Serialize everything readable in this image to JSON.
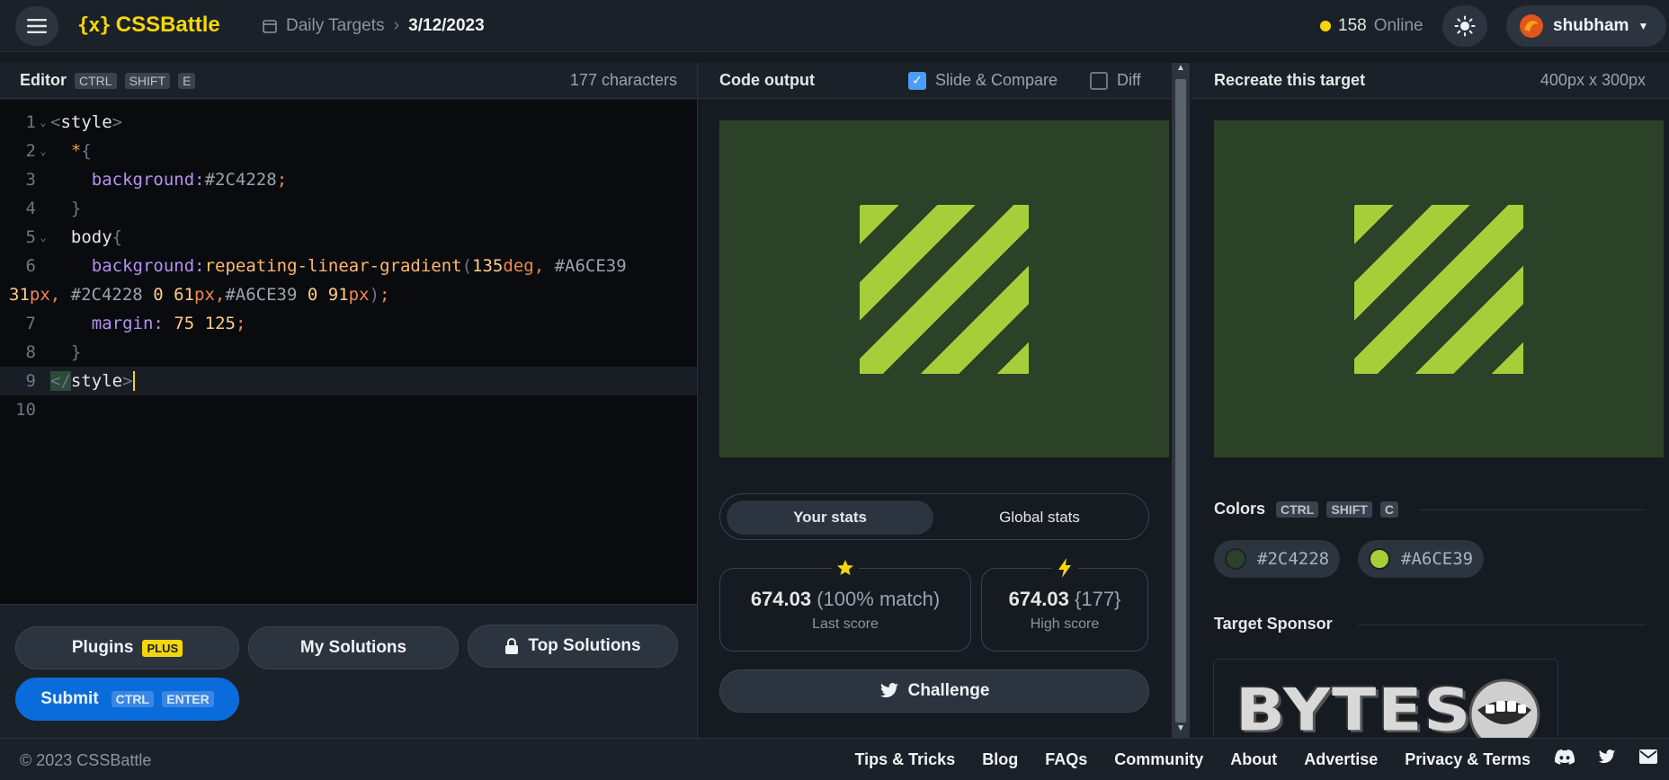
{
  "header": {
    "brand": "CSSBattle",
    "brand_mark": "{x}",
    "crumbs": [
      "Daily Targets",
      "3/12/2023"
    ],
    "online_count": "158",
    "online_label": "Online",
    "username": "shubham"
  },
  "editor": {
    "title": "Editor",
    "shortcut": [
      "CTRL",
      "SHIFT",
      "E"
    ],
    "char_count": "177 characters",
    "line_numbers": [
      "1",
      "2",
      "3",
      "4",
      "5",
      "6",
      "",
      "7",
      "8",
      "9",
      "10"
    ]
  },
  "code_tokens": {
    "style_tag": "style",
    "star": "*",
    "bg_prop": "background",
    "bg_val": "#2C4228",
    "body_sel": "body",
    "fn_name": "repeating-linear-gradient",
    "deg": "135",
    "deg_unit": "deg",
    "c1": "#A6CE39",
    "n31": "31",
    "c2": "#2C4228",
    "zero": "0",
    "n61": "61",
    "c3": "#A6CE39",
    "n91": "91",
    "px": "px",
    "margin_prop": "margin",
    "margin_val": "75 125"
  },
  "editor_buttons": {
    "plugins": "Plugins",
    "plus": "PLUS",
    "my_solutions": "My Solutions",
    "top_solutions": "Top Solutions",
    "submit": "Submit",
    "submit_keys": [
      "CTRL",
      "ENTER"
    ]
  },
  "output": {
    "title": "Code output",
    "slide_compare": "Slide & Compare",
    "diff": "Diff",
    "tabs": [
      "Your stats",
      "Global stats"
    ],
    "last_score": "674.03",
    "last_score_extra": "(100% match)",
    "last_score_label": "Last score",
    "high_score": "674.03",
    "high_score_extra": "{177}",
    "high_score_label": "High score",
    "challenge": "Challenge"
  },
  "target": {
    "title": "Recreate this target",
    "size": "400px x 300px",
    "colors_title": "Colors",
    "colors_keys": [
      "CTRL",
      "SHIFT",
      "C"
    ],
    "colors": [
      "#2C4228",
      "#A6CE39"
    ],
    "sponsor_title": "Target Sponsor",
    "sponsor_text": "BYTES"
  },
  "footer": {
    "copyright": "© 2023 CSSBattle",
    "links": [
      "Tips & Tricks",
      "Blog",
      "FAQs",
      "Community",
      "About",
      "Advertise",
      "Privacy & Terms"
    ]
  },
  "colors": {
    "dark_green": "#2C4228",
    "lime": "#A6CE39",
    "accent_yellow": "#f5d60a",
    "submit_blue": "#0a6cdb"
  }
}
